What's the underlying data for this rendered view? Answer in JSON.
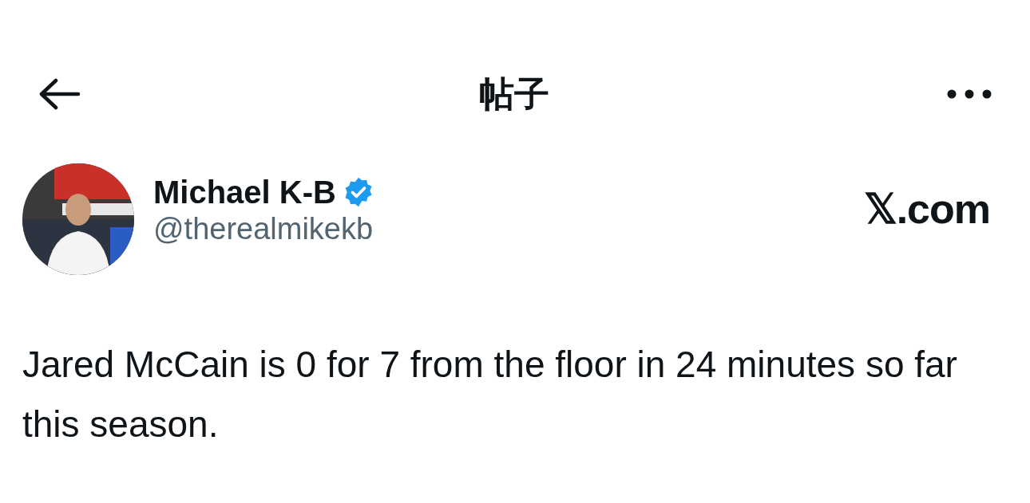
{
  "header": {
    "title": "帖子"
  },
  "post": {
    "author": {
      "name": "Michael K-B",
      "verified": true,
      "handle": "@therealmikekb"
    },
    "source": "𝕏.com",
    "text": "Jared McCain is 0 for 7 from the floor in 24 minutes so far this season."
  }
}
